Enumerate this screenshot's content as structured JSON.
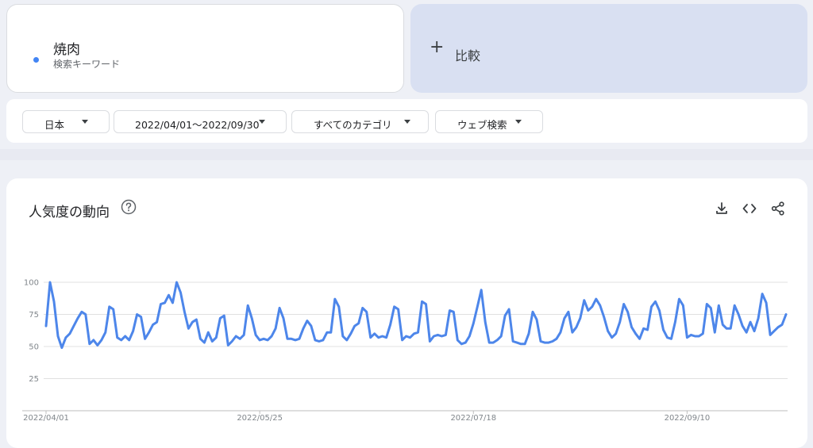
{
  "term": {
    "name": "焼肉",
    "type": "検索キーワード",
    "color": "#4285f4"
  },
  "compare": {
    "plus": "+",
    "label": "比較"
  },
  "filters": [
    {
      "label": "日本"
    },
    {
      "label": "2022/04/01〜2022/09/30"
    },
    {
      "label": "すべてのカテゴリ"
    },
    {
      "label": "ウェブ検索"
    }
  ],
  "chart": {
    "title": "人気度の動向",
    "tools": [
      "download-icon",
      "embed-icon",
      "share-icon"
    ]
  },
  "chart_data": {
    "type": "line",
    "title": "人気度の動向",
    "xlabel": "",
    "ylabel": "",
    "ylim": [
      0,
      100
    ],
    "yticks": [
      25,
      50,
      75,
      100
    ],
    "xtick_labels": [
      "2022/04/01",
      "2022/05/25",
      "2022/07/18",
      "2022/09/10"
    ],
    "xtick_index": [
      0,
      54,
      108,
      162
    ],
    "grid": true,
    "series": [
      {
        "color": "#4d86ea",
        "start": "2022/04/01",
        "values": [
          66,
          100,
          85,
          58,
          49,
          57,
          60,
          66,
          72,
          77,
          75,
          52,
          55,
          51,
          55,
          61,
          81,
          79,
          57,
          55,
          58,
          55,
          62,
          75,
          73,
          56,
          61,
          67,
          69,
          83,
          84,
          90,
          84,
          100,
          92,
          77,
          64,
          69,
          71,
          56,
          53,
          61,
          54,
          57,
          72,
          74,
          51,
          54,
          58,
          56,
          59,
          82,
          72,
          59,
          55,
          56,
          55,
          58,
          64,
          80,
          72,
          56,
          56,
          55,
          56,
          64,
          70,
          66,
          55,
          54,
          55,
          61,
          61,
          87,
          81,
          58,
          55,
          60,
          66,
          68,
          80,
          77,
          57,
          60,
          57,
          58,
          57,
          67,
          81,
          79,
          55,
          58,
          57,
          60,
          61,
          85,
          83,
          54,
          58,
          59,
          58,
          59,
          78,
          77,
          55,
          52,
          53,
          58,
          68,
          81,
          94,
          69,
          53,
          53,
          55,
          58,
          74,
          79,
          54,
          53,
          52,
          52,
          60,
          77,
          71,
          54,
          53,
          53,
          54,
          56,
          61,
          72,
          77,
          61,
          65,
          72,
          86,
          78,
          81,
          87,
          82,
          73,
          62,
          57,
          60,
          69,
          83,
          77,
          65,
          60,
          56,
          64,
          63,
          81,
          85,
          78,
          63,
          57,
          56,
          69,
          87,
          82,
          57,
          59,
          58,
          58,
          60,
          83,
          80,
          61,
          82,
          67,
          64,
          64,
          82,
          75,
          66,
          61,
          69,
          62,
          72,
          91,
          84,
          59,
          62,
          65,
          67,
          75
        ]
      }
    ]
  }
}
